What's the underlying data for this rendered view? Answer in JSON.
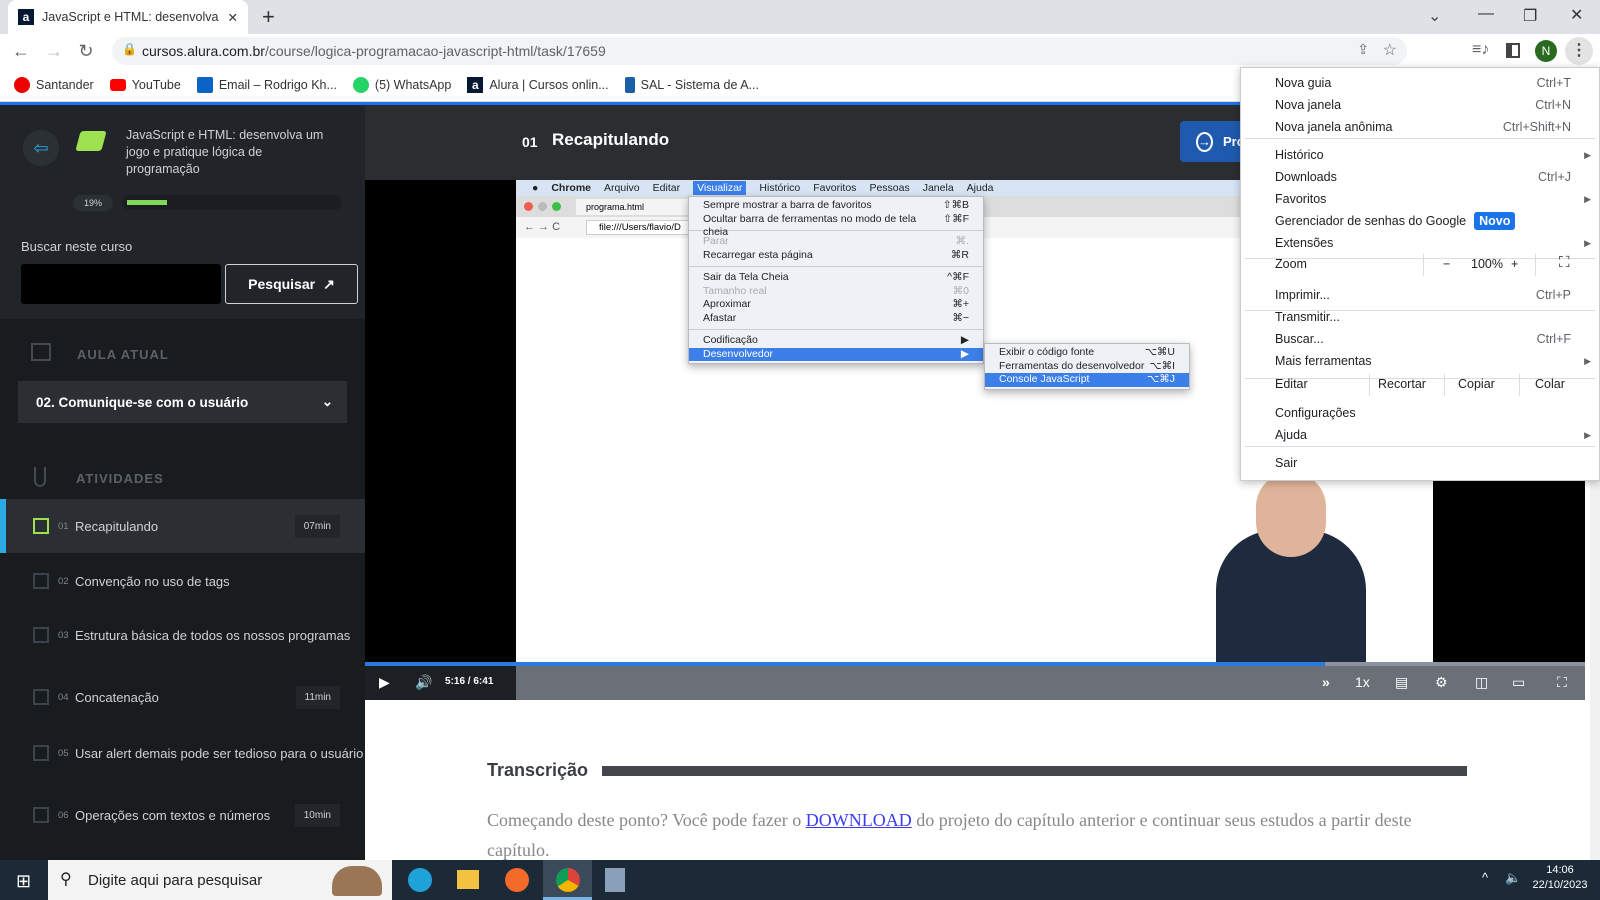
{
  "browser": {
    "tab_title": "JavaScript e HTML: desenvolva um jogo e pratique lógica de programação",
    "url_host": "cursos.alura.com.br",
    "url_path": "/course/logica-programacao-javascript-html/task/17659",
    "avatar_letter": "N",
    "bookmarks": [
      {
        "label": "Santander",
        "icon": "santander-icon",
        "color": "#ec0000"
      },
      {
        "label": "YouTube",
        "icon": "youtube-icon",
        "color": "#ff0000"
      },
      {
        "label": "Email – Rodrigo Kh...",
        "icon": "outlook-icon",
        "color": "#0a64c8"
      },
      {
        "label": "(5) WhatsApp",
        "icon": "whatsapp-icon",
        "color": "#25d366"
      },
      {
        "label": "Alura | Cursos onlin...",
        "icon": "alura-icon",
        "color": "#051933"
      },
      {
        "label": "SAL - Sistema de A...",
        "icon": "sal-icon",
        "color": "#1a5fa8"
      }
    ]
  },
  "sidebar": {
    "course_title": "JavaScript e HTML: desenvolva um jogo e pratique lógica de programação",
    "progress_label": "19%",
    "progress_value": 19,
    "search_label": "Buscar neste curso",
    "search_value": "",
    "search_button": "Pesquisar",
    "current_lesson_heading": "AULA ATUAL",
    "current_lesson": "02. Comunique-se com o usuário",
    "activities_heading": "ATIVIDADES",
    "activities": [
      {
        "num": "01",
        "label": "Recapitulando",
        "duration": "07min",
        "icon": "video-icon",
        "active": true
      },
      {
        "num": "02",
        "label": "Convenção no uso de tags",
        "duration": "",
        "icon": "list-icon"
      },
      {
        "num": "03",
        "label": "Estrutura básica de todos os nossos programas",
        "duration": "",
        "icon": "book-icon"
      },
      {
        "num": "04",
        "label": "Concatenação",
        "duration": "11min",
        "icon": "video-icon"
      },
      {
        "num": "05",
        "label": "Usar alert demais pode ser tedioso para o usuário",
        "duration": "",
        "icon": "list-icon"
      },
      {
        "num": "06",
        "label": "Operações com textos e números",
        "duration": "10min",
        "icon": "video-icon"
      }
    ]
  },
  "content": {
    "task_num": "01",
    "task_title": "Recapitulando",
    "next_button": "Próxima Atividade",
    "video": {
      "current_time": "5:16",
      "separator": "/",
      "duration": "6:41",
      "progress_fraction": 0.787,
      "speed": "1x",
      "mac_menubar": [
        "Chrome",
        "Arquivo",
        "Editar",
        "Visualizar",
        "Histórico",
        "Favoritos",
        "Pessoas",
        "Janela",
        "Ajuda"
      ],
      "mac_tab": "programa.html",
      "mac_url": "file:///Users/flavio/D",
      "view_menu": [
        {
          "label": "Sempre mostrar a barra de favoritos",
          "sc": "⇧⌘B"
        },
        {
          "label": "Ocultar barra de ferramentas no modo de tela cheia",
          "sc": "⇧⌘F"
        },
        {
          "sep": true
        },
        {
          "label": "Parar",
          "sc": "⌘.",
          "dis": true
        },
        {
          "label": "Recarregar esta página",
          "sc": "⌘R"
        },
        {
          "sep": true
        },
        {
          "label": "Sair da Tela Cheia",
          "sc": "^⌘F"
        },
        {
          "label": "Tamanho real",
          "sc": "⌘0",
          "dis": true
        },
        {
          "label": "Aproximar",
          "sc": "⌘+"
        },
        {
          "label": "Afastar",
          "sc": "⌘−"
        },
        {
          "sep": true
        },
        {
          "label": "Codificação",
          "sc": "▶"
        },
        {
          "label": "Desenvolvedor",
          "sc": "▶",
          "hl": true
        }
      ],
      "dev_menu": [
        {
          "label": "Exibir o código fonte",
          "sc": "⌥⌘U"
        },
        {
          "label": "Ferramentas do desenvolvedor",
          "sc": "⌥⌘I"
        },
        {
          "label": "Console JavaScript",
          "sc": "⌥⌘J",
          "hl": true
        }
      ]
    },
    "transcription_heading": "Transcrição",
    "para_before": "Começando deste ponto? Você pode fazer o ",
    "para_link": "DOWNLOAD",
    "para_after": " do projeto do capítulo anterior e continuar seus estudos a partir deste capítulo."
  },
  "chrome_menu": {
    "items": [
      {
        "label": "Nova guia",
        "sc": "Ctrl+T"
      },
      {
        "label": "Nova janela",
        "sc": "Ctrl+N"
      },
      {
        "label": "Nova janela anônima",
        "sc": "Ctrl+Shift+N"
      },
      {
        "label": "Histórico",
        "sub": true
      },
      {
        "label": "Downloads",
        "sc": "Ctrl+J"
      },
      {
        "label": "Favoritos",
        "sub": true
      },
      {
        "label": "Gerenciador de senhas do Google",
        "badge": "Novo"
      },
      {
        "label": "Extensões",
        "sub": true
      },
      {
        "label": "Imprimir...",
        "sc": "Ctrl+P"
      },
      {
        "label": "Transmitir..."
      },
      {
        "label": "Buscar...",
        "sc": "Ctrl+F"
      },
      {
        "label": "Mais ferramentas",
        "sub": true
      },
      {
        "label": "Configurações"
      },
      {
        "label": "Ajuda",
        "sub": true
      },
      {
        "label": "Sair"
      }
    ],
    "zoom_label": "Zoom",
    "zoom_minus": "−",
    "zoom_value": "100%",
    "zoom_plus": "+",
    "edit_label": "Editar",
    "cut": "Recortar",
    "copy": "Copiar",
    "paste": "Colar"
  },
  "taskbar": {
    "search_placeholder": "Digite aqui para pesquisar",
    "time": "14:06",
    "date": "22/10/2023"
  }
}
